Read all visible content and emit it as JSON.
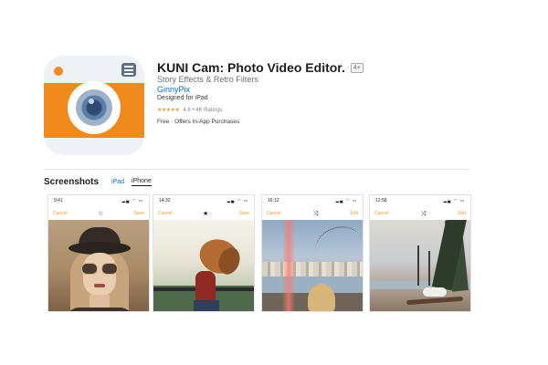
{
  "app": {
    "title": "KUNI Cam: Photo Video Editor.",
    "age_rating": "4+",
    "subtitle": "Story Effects & Retro Filters",
    "developer": "GinnyPix",
    "designed_for": "Designed for iPad",
    "stars": "★★★★★",
    "rating_text": "4.6 • 4K Ratings",
    "price": "Free · Offers In-App Purchases"
  },
  "screenshots": {
    "title": "Screenshots",
    "tabs": [
      {
        "label": "iPad",
        "active": false
      },
      {
        "label": "iPhone",
        "active": true
      }
    ],
    "items": [
      {
        "time": "9:41",
        "left": "Cancel",
        "mid_icon": "star-outline-icon",
        "mid_glyph": "☆",
        "right": "Save"
      },
      {
        "time": "14:32",
        "left": "Cancel",
        "mid_icon": "star-filled-icon",
        "mid_glyph": "★",
        "right": "Save"
      },
      {
        "time": "16:12",
        "left": "Cancel",
        "mid_icon": "shuffle-icon",
        "mid_glyph": "⤨",
        "right": "Edit"
      },
      {
        "time": "12:58",
        "left": "Cancel",
        "mid_icon": "shuffle-icon",
        "mid_glyph": "⤨",
        "right": "Edit"
      }
    ]
  },
  "colors": {
    "brand_orange": "#f08a1c",
    "link_blue": "#0070c9",
    "star_orange": "#f09a37"
  }
}
